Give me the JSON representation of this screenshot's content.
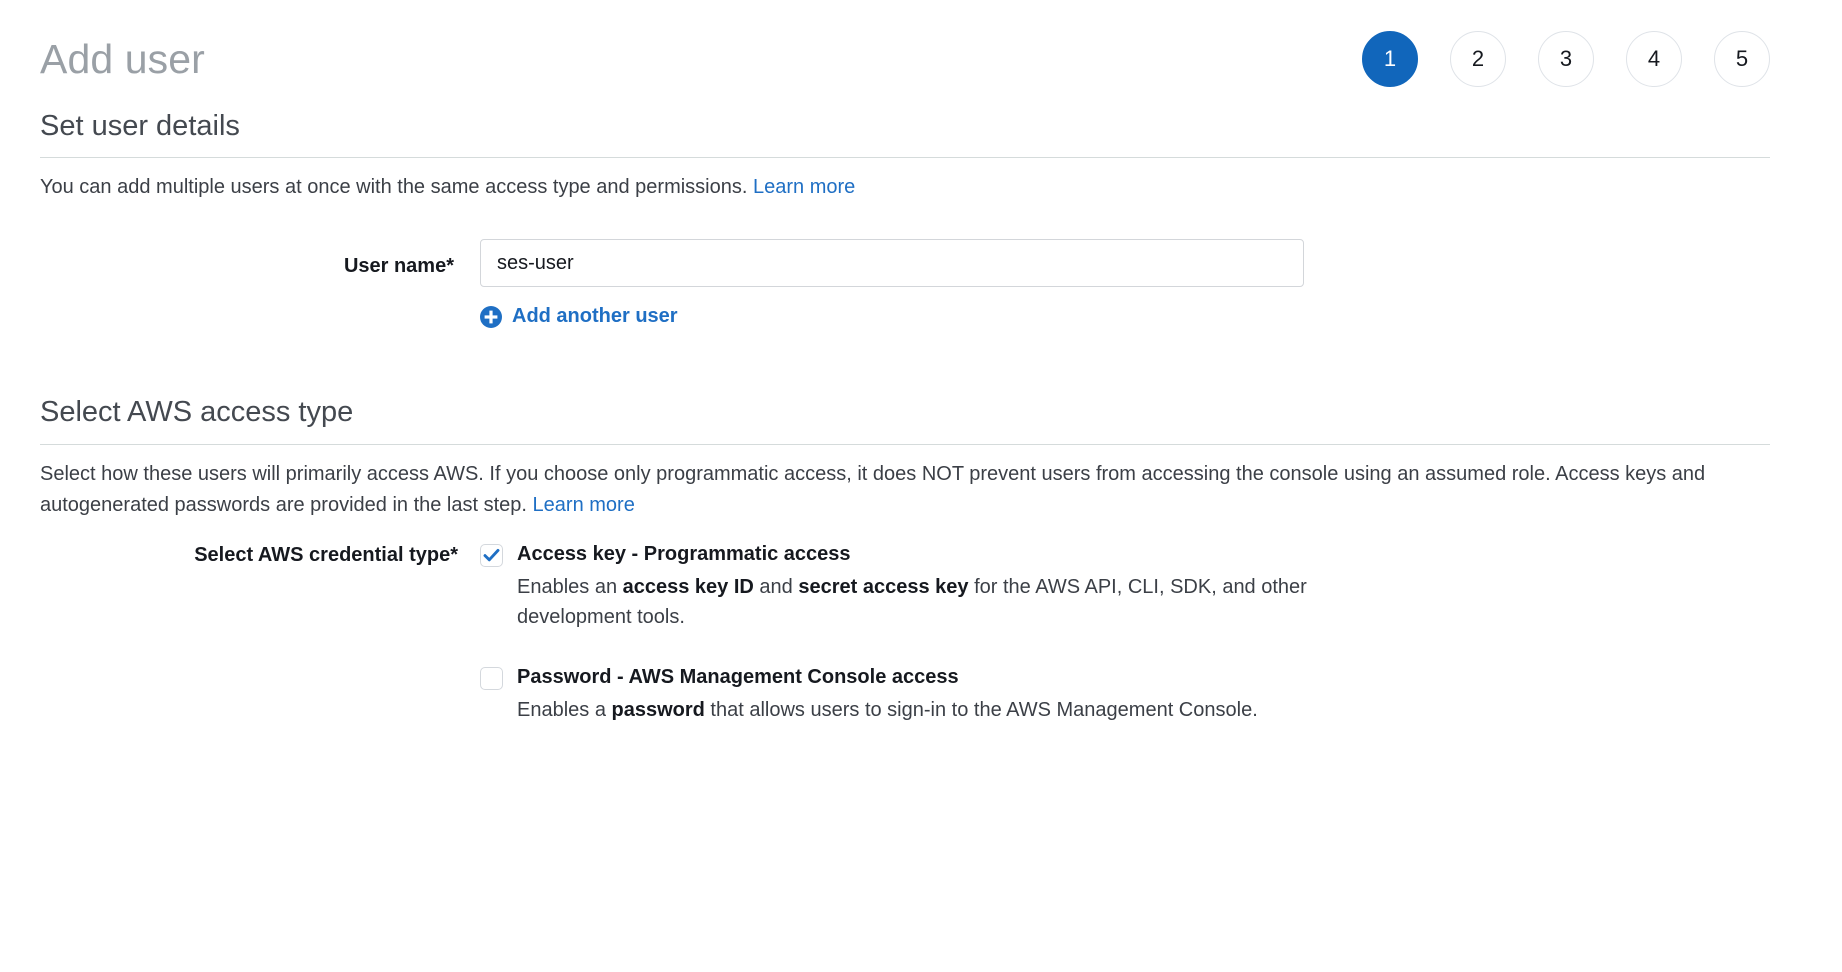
{
  "header": {
    "title": "Add user",
    "steps": [
      {
        "label": "1",
        "active": true
      },
      {
        "label": "2",
        "active": false
      },
      {
        "label": "3",
        "active": false
      },
      {
        "label": "4",
        "active": false
      },
      {
        "label": "5",
        "active": false
      }
    ]
  },
  "colors": {
    "accent_blue": "#1166bb",
    "link_blue": "#1f6fc4",
    "title_gray": "#9aa0a6",
    "heading_gray": "#444950",
    "rule_gray": "#d5dbdb",
    "text": "#16191f"
  },
  "user_details": {
    "section_title": "Set user details",
    "description": "You can add multiple users at once with the same access type and permissions.",
    "learn_more": "Learn more",
    "user_name_label": "User name*",
    "user_name_value": "ses-user",
    "user_name_placeholder": "",
    "add_another_user": "Add another user",
    "add_icon": "plus-circle-icon"
  },
  "access_type": {
    "section_title": "Select AWS access type",
    "description": "Select how these users will primarily access AWS. If you choose only programmatic access, it does NOT prevent users from accessing the console using an assumed role. Access keys and autogenerated passwords are provided in the last step.",
    "learn_more": "Learn more",
    "credential_type_label": "Select AWS credential type*",
    "options": [
      {
        "id": "access-key",
        "title": "Access key - Programmatic access",
        "checked": true,
        "desc_part1": "Enables an ",
        "desc_bold1": "access key ID",
        "desc_part2": " and ",
        "desc_bold2": "secret access key",
        "desc_part3": " for the AWS API, CLI, SDK, and other development tools."
      },
      {
        "id": "password",
        "title": "Password - AWS Management Console access",
        "checked": false,
        "desc_part1": "Enables a ",
        "desc_bold1": "password",
        "desc_part2": " that allows users to sign-in to the AWS Management Console.",
        "desc_bold2": "",
        "desc_part3": ""
      }
    ]
  }
}
